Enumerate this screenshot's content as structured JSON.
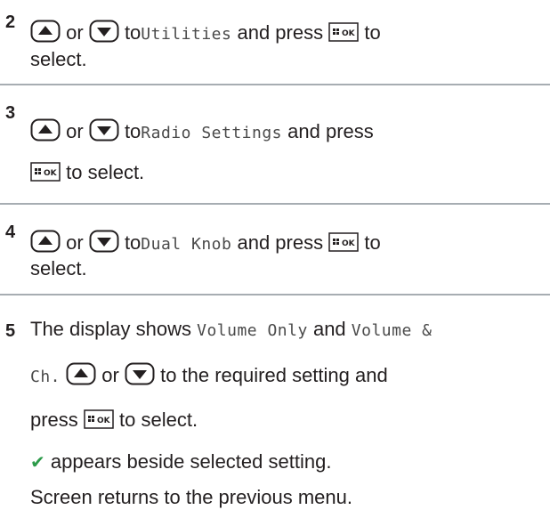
{
  "steps": [
    {
      "number": "2",
      "or": "or",
      "to": "to",
      "menu_item": "Utilities",
      "and_press": "and press",
      "to2": "to",
      "select": "select."
    },
    {
      "number": "3",
      "or": "or",
      "to": "to",
      "menu_item": "Radio Settings",
      "and_press": "and press",
      "to_select": "to select."
    },
    {
      "number": "4",
      "or": "or",
      "to": "to",
      "menu_item": "Dual Knob",
      "and_press": "and press",
      "to2": "to",
      "select": "select."
    },
    {
      "number": "5",
      "display_shows": "The display shows",
      "option_1": "Volume Only",
      "and": "and",
      "option_2a": "Volume &",
      "option_2b": "Ch.",
      "or": "or",
      "to_required": "to the required setting and",
      "press": "press",
      "to_select": "to select.",
      "check_note": "appears beside selected setting.",
      "return_note": "Screen returns to the previous menu."
    }
  ],
  "icons": {
    "up_key": "up-arrow-key-icon",
    "down_key": "down-arrow-key-icon",
    "ok_key": "menu-ok-key-icon",
    "check": "checkmark-icon"
  },
  "ok_key_label": "OK",
  "colors": {
    "rule": "#a7adb2",
    "check": "#2d9b4a",
    "text": "#231f20"
  }
}
